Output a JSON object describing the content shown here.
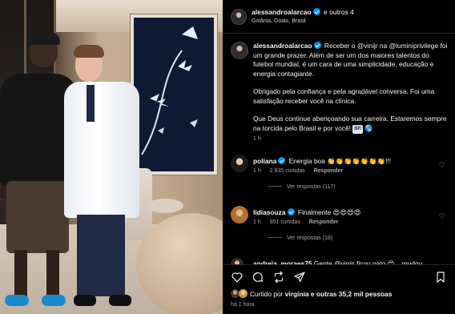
{
  "post": {
    "author": "alessandroalarcao",
    "coauthors": "e outros 4",
    "location": "Goiânia, Goiás, Brasil"
  },
  "caption": {
    "username": "alessandroalarcao",
    "p1_a": "Receber o ",
    "mention1": "@vinijr",
    "p1_b": " na ",
    "mention2": "@luminiprivilege",
    "p1_c": " foi um grande prazer. Além de ser um dos maiores talentos do futebol mundial, é um cara de uma simplicidade, educação e energia contagiante.",
    "p2": "Obrigado pela confiança e pela agradável conversa. Foi uma satisfação receber você na clínica.",
    "p3": "Que Deus continue abençoando sua carreira. Estaremos sempre na torcida pelo Brasil e por você!",
    "flag": "BR",
    "emoji_end": "🌎",
    "time": "1 h"
  },
  "comments": [
    {
      "username": "poliana",
      "text": "Energia boa 👏👏👏👏👏👏👏!!!",
      "time": "1 h",
      "likes": "2.935 curtidas",
      "reply": "Responder",
      "replies": "Ver respostas (117)"
    },
    {
      "username": "lidiasouza",
      "text": "Finalmente 😍😍😍😍",
      "time": "1 h",
      "likes": "851 curtidas",
      "reply": "Responder",
      "replies": "Ver respostas (18)"
    }
  ],
  "partial_comment": {
    "username": "andreia_moraes75",
    "text": "Gente @vinijr ficou gato 😊 ...mudou"
  },
  "footer": {
    "liked_by_prefix": "Curtido por ",
    "liked_by_user": "virginia",
    "liked_by_suffix": " e outras 35,2 mil pessoas",
    "ago": "há 1 hora"
  },
  "icons": [
    "heart-icon",
    "comment-icon",
    "repost-icon",
    "share-icon",
    "bookmark-icon"
  ]
}
